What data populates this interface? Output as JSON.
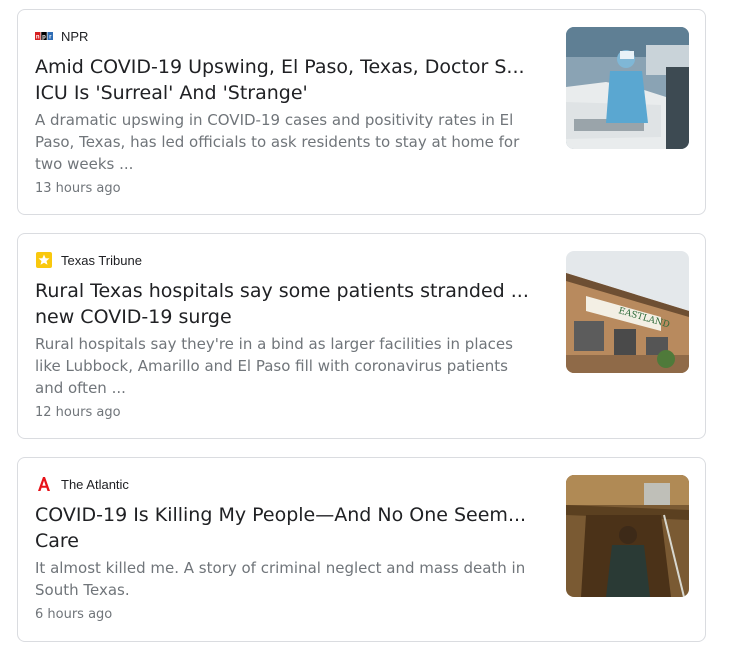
{
  "articles": [
    {
      "source": "NPR",
      "source_logo": "npr-logo",
      "headline_line1": "Amid COVID-19 Upswing, El Paso, Texas, Doctor S...",
      "headline_line2": "ICU Is 'Surreal' And 'Strange'",
      "snippet_line1": "A dramatic upswing in COVID-19 cases and positivity rates in El",
      "snippet_line2": "Paso, Texas, has led officials to ask residents to stay at home for",
      "snippet_line3": "two weeks ...",
      "time": "13 hours ago",
      "thumbnail": "health-worker-at-car-testing-site"
    },
    {
      "source": "Texas Tribune",
      "source_logo": "star-logo",
      "headline_line1": "Rural Texas hospitals say some patients stranded ...",
      "headline_line2": "new COVID-19 surge",
      "snippet_line1": "Rural hospitals say they're in a bind as larger facilities in places",
      "snippet_line2": "like Lubbock, Amarillo and El Paso fill with coronavirus patients",
      "snippet_line3": "and often ...",
      "time": "12 hours ago",
      "thumbnail": "eastland-memorial-hospital-building",
      "thumbnail_text": "EASTLAND"
    },
    {
      "source": "The Atlantic",
      "source_logo": "atlantic-a-logo",
      "headline_line1": "COVID-19 Is Killing My People—And No One Seem...",
      "headline_line2": "Care",
      "snippet_line1": "It almost killed me. A story of criminal neglect and mass death in",
      "snippet_line2": "South Texas.",
      "time": "6 hours ago",
      "thumbnail": "man-in-grave-plot"
    }
  ],
  "colors": {
    "headline": "#202124",
    "snippet": "#70757a",
    "border": "#dadce0",
    "atlantic_red": "#e7131a",
    "tribune_star": "#f9c80e"
  }
}
